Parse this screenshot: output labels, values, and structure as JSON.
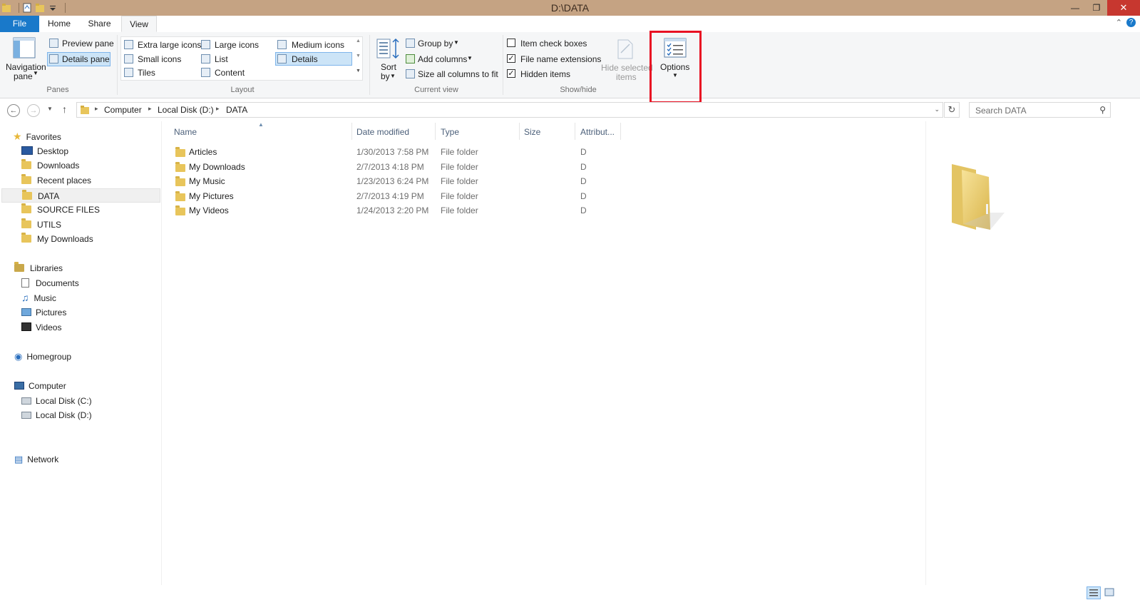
{
  "window": {
    "title": "D:\\DATA"
  },
  "tabs": [
    {
      "label": "File",
      "name": "tab-file"
    },
    {
      "label": "Home",
      "name": "tab-home"
    },
    {
      "label": "Share",
      "name": "tab-share"
    },
    {
      "label": "View",
      "name": "tab-view"
    }
  ],
  "ribbon": {
    "panes": {
      "navigation_pane": "Navigation",
      "navigation_pane2": "pane",
      "preview_pane": "Preview pane",
      "details_pane": "Details pane",
      "group_label": "Panes"
    },
    "layout": {
      "extra_large": "Extra large icons",
      "large": "Large icons",
      "medium": "Medium icons",
      "small": "Small icons",
      "list": "List",
      "details": "Details",
      "tiles": "Tiles",
      "content": "Content",
      "group_label": "Layout"
    },
    "current_view": {
      "sort": "Sort",
      "sort2": "by",
      "group_by": "Group by",
      "add_columns": "Add columns",
      "size_all": "Size all columns to fit",
      "group_label": "Current view"
    },
    "show_hide": {
      "item_check_boxes": "Item check boxes",
      "file_name_extensions": "File name extensions",
      "hidden_items": "Hidden items",
      "hide_selected": "Hide selected",
      "hide_selected2": "items",
      "group_label": "Show/hide"
    },
    "options": {
      "label": "Options"
    },
    "checkboxes": {
      "item_check_boxes": false,
      "file_name_extensions": true,
      "hidden_items": true
    }
  },
  "address": {
    "crumbs": [
      "Computer",
      "Local Disk (D:)",
      "DATA"
    ],
    "search_placeholder": "Search DATA"
  },
  "nav": {
    "favorites": "Favorites",
    "favorites_items": [
      "Desktop",
      "Downloads",
      "Recent places",
      "DATA",
      "SOURCE FILES",
      "UTILS",
      "My Downloads"
    ],
    "libraries": "Libraries",
    "libraries_items": [
      "Documents",
      "Music",
      "Pictures",
      "Videos"
    ],
    "homegroup": "Homegroup",
    "computer": "Computer",
    "computer_items": [
      "Local Disk (C:)",
      "Local Disk (D:)"
    ],
    "network": "Network"
  },
  "columns": [
    "Name",
    "Date modified",
    "Type",
    "Size",
    "Attribut..."
  ],
  "files": [
    {
      "name": "Articles",
      "date": "1/30/2013 7:58 PM",
      "type": "File folder",
      "size": "",
      "attr": "D"
    },
    {
      "name": "My Downloads",
      "date": "2/7/2013 4:18 PM",
      "type": "File folder",
      "size": "",
      "attr": "D"
    },
    {
      "name": "My Music",
      "date": "1/23/2013 6:24 PM",
      "type": "File folder",
      "size": "",
      "attr": "D"
    },
    {
      "name": "My Pictures",
      "date": "2/7/2013 4:19 PM",
      "type": "File folder",
      "size": "",
      "attr": "D"
    },
    {
      "name": "My Videos",
      "date": "1/24/2013 2:20 PM",
      "type": "File folder",
      "size": "",
      "attr": "D"
    }
  ],
  "colors": {
    "title_bar": "#c5a383",
    "file_tab": "#1979ca",
    "highlight": "#e81123",
    "selection": "#cce4f7"
  }
}
